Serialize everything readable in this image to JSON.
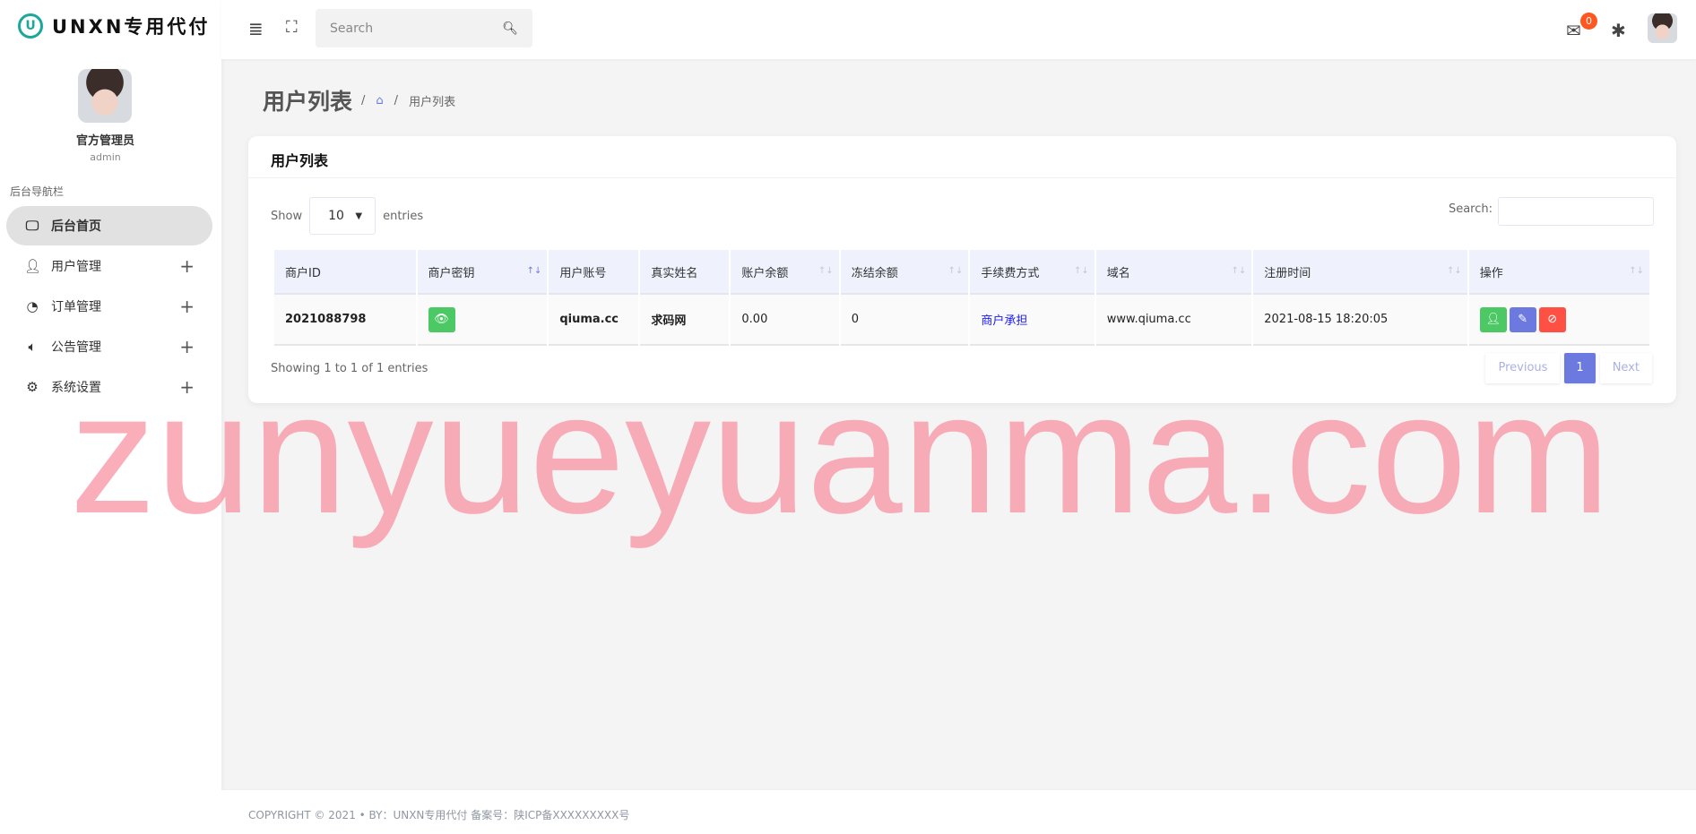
{
  "app": {
    "logo_mark": "U",
    "title": "UNXN专用代付"
  },
  "user": {
    "name": "官方管理员",
    "role": "admin"
  },
  "sidebar": {
    "section": "后台导航栏",
    "items": [
      {
        "label": "后台首页",
        "icon": "monitor-icon",
        "active": true
      },
      {
        "label": "用户管理",
        "icon": "user-icon"
      },
      {
        "label": "订单管理",
        "icon": "pie-chart-icon"
      },
      {
        "label": "公告管理",
        "icon": "speaker-icon"
      },
      {
        "label": "系统设置",
        "icon": "gear-icon"
      }
    ]
  },
  "topbar": {
    "search_placeholder": "Search",
    "notifications": "0"
  },
  "page": {
    "title": "用户列表",
    "breadcrumb": "用户列表"
  },
  "card": {
    "title": "用户列表",
    "show": "Show",
    "entries_value": "10",
    "entries": "entries",
    "search_label": "Search:",
    "columns": [
      "商户ID",
      "商户密钥",
      "用户账号",
      "真实姓名",
      "账户余额",
      "冻结余额",
      "手续费方式",
      "域名",
      "注册时间",
      "操作"
    ],
    "rows": [
      {
        "id": "2021088798",
        "account": "qiuma.cc",
        "name": "求码网",
        "balance": "0.00",
        "frozen": "0",
        "fee": "商户承担",
        "domain": "www.qiuma.cc",
        "time": "2021-08-15 18:20:05"
      }
    ],
    "info": "Showing 1 to 1 of 1 entries",
    "prev": "Previous",
    "page": "1",
    "next": "Next"
  },
  "colors": {
    "green": "#4cc964",
    "blue": "#6c7ae0",
    "red": "#ff5044",
    "link": "#1a1aff"
  },
  "footer": "COPYRIGHT © 2021  • BY：UNXN专用代付    备案号：陕ICP备XXXXXXXXX号",
  "watermark": "zunyueyuanma.com"
}
